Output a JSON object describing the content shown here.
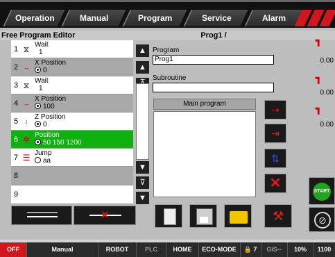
{
  "menu": {
    "tabs": [
      "Operation",
      "Manual",
      "Program",
      "Service",
      "Alarm"
    ]
  },
  "editor": {
    "title": "Free Program Editor",
    "program_name": "Prog1 /",
    "rows": [
      {
        "num": "1",
        "icon": "hourglass-icon",
        "label": "Wait",
        "value": "1",
        "radio": false
      },
      {
        "num": "2",
        "icon": "x-axis-icon",
        "label": "X Position",
        "value": "0",
        "radio": true
      },
      {
        "num": "3",
        "icon": "hourglass-icon",
        "label": "Wait",
        "value": "1",
        "radio": false
      },
      {
        "num": "4",
        "icon": "x-axis-icon",
        "label": "X Position",
        "value": "100",
        "radio": true
      },
      {
        "num": "5",
        "icon": "z-axis-icon",
        "label": "Z Position",
        "value": "0",
        "radio": true
      },
      {
        "num": "6",
        "icon": "position-icon",
        "label": "Position",
        "value": "50   150   1200",
        "radio": true
      },
      {
        "num": "7",
        "icon": "jump-icon",
        "label": "Jump",
        "value": "aa",
        "radio": true
      },
      {
        "num": "8",
        "icon": "",
        "label": "",
        "value": "",
        "radio": false
      },
      {
        "num": "9",
        "icon": "",
        "label": "",
        "value": "",
        "radio": false
      }
    ]
  },
  "program": {
    "label": "Program",
    "value": "Prog1",
    "subroutine_label": "Subroutine",
    "subroutine_value": "",
    "main_program_label": "Main program"
  },
  "axes": [
    {
      "axis": "X",
      "value": "0.00"
    },
    {
      "axis": "Y",
      "value": "0.00"
    },
    {
      "axis": "Z",
      "value": "0.00"
    }
  ],
  "start_label": "START",
  "status": {
    "off": "OFF",
    "manual": "Manual",
    "robot": "ROBOT",
    "plc": "PLC",
    "home": "HOME",
    "eco": "ECO-MODE",
    "count": "7",
    "gis": "GIS--",
    "percent": "10%",
    "speed": "1100"
  },
  "colors": {
    "selected_row": "#10b010",
    "accent_red": "#d0161e",
    "start_green": "#1fa51f"
  }
}
